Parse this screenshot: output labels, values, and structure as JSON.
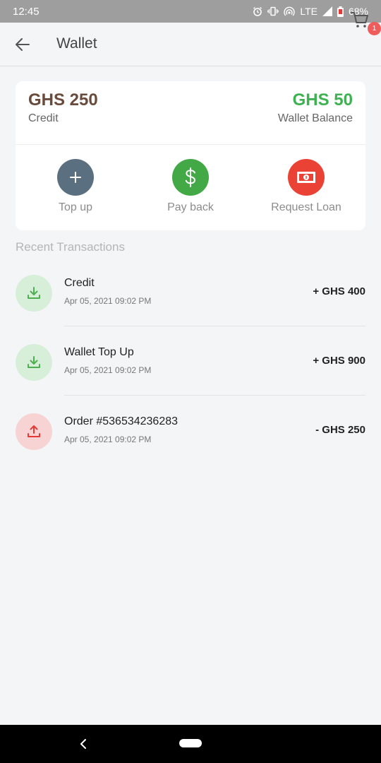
{
  "status_bar": {
    "time": "12:45",
    "network": "LTE",
    "battery": "68%"
  },
  "app_bar": {
    "title": "Wallet",
    "cart_badge": "1"
  },
  "summary": {
    "credit_amount": "GHS 250",
    "credit_label": "Credit",
    "wallet_amount": "GHS 50",
    "wallet_label": "Wallet Balance",
    "actions": [
      {
        "label": "Top up",
        "icon": "plus-icon",
        "color": "#5a7080"
      },
      {
        "label": "Pay back",
        "icon": "dollar-icon",
        "color": "#43a947"
      },
      {
        "label": "Request Loan",
        "icon": "banknote-icon",
        "color": "#ea4335"
      }
    ]
  },
  "recent": {
    "title": "Recent Transactions",
    "transactions": [
      {
        "title": "Credit",
        "date": "Apr 05, 2021 09:02 PM",
        "amount": "+ GHS 400",
        "direction": "in"
      },
      {
        "title": "Wallet Top Up",
        "date": "Apr 05, 2021 09:02 PM",
        "amount": "+ GHS 900",
        "direction": "in"
      },
      {
        "title": "Order #536534236283",
        "date": "Apr 05, 2021 09:02 PM",
        "amount": "- GHS 250",
        "direction": "out"
      }
    ]
  },
  "colors": {
    "credit": "#6a4a3a",
    "wallet_balance": "#3db251",
    "incoming_bg": "#d7eed9",
    "incoming_icon": "#4caf50",
    "outgoing_bg": "#f8d3d3",
    "outgoing_icon": "#e53935"
  }
}
